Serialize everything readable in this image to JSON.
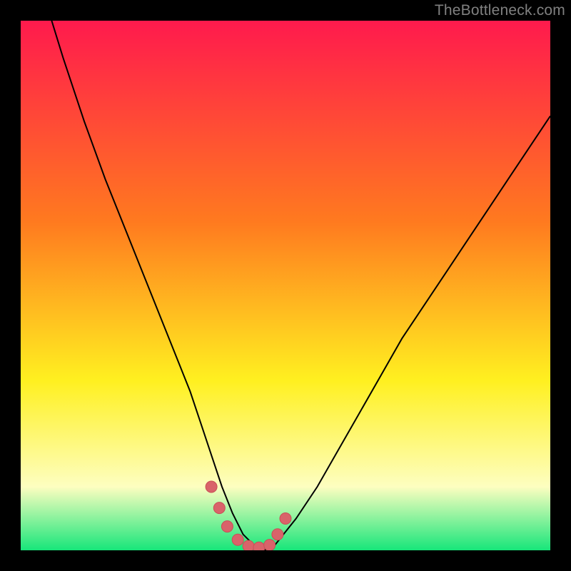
{
  "watermark": "TheBottleneck.com",
  "colors": {
    "frame": "#000000",
    "grad_top": "#ff1a4d",
    "grad_mid1": "#ff7a1f",
    "grad_mid2": "#fff020",
    "grad_low": "#fdfec0",
    "grad_bottom": "#17e67a",
    "curve": "#000000",
    "marker_fill": "#d9636a",
    "marker_stroke": "#c94f56"
  },
  "chart_data": {
    "type": "line",
    "title": "",
    "xlabel": "",
    "ylabel": "",
    "xlim": [
      0,
      100
    ],
    "ylim": [
      0,
      100
    ],
    "x": [
      0,
      4,
      8,
      12,
      16,
      20,
      24,
      28,
      30,
      32,
      34,
      36,
      38,
      40,
      42,
      44,
      46,
      48,
      52,
      56,
      60,
      64,
      68,
      72,
      76,
      80,
      84,
      88,
      92,
      96,
      100
    ],
    "values": [
      122,
      106,
      93,
      81,
      70,
      60,
      50,
      40,
      35,
      30,
      24,
      18,
      12,
      7,
      3,
      1,
      0,
      1,
      6,
      12,
      19,
      26,
      33,
      40,
      46,
      52,
      58,
      64,
      70,
      76,
      82
    ],
    "series": [
      {
        "name": "bottleneck-curve",
        "x": [
          0,
          4,
          8,
          12,
          16,
          20,
          24,
          28,
          30,
          32,
          34,
          36,
          38,
          40,
          42,
          44,
          46,
          48,
          52,
          56,
          60,
          64,
          68,
          72,
          76,
          80,
          84,
          88,
          92,
          96,
          100
        ],
        "values": [
          122,
          106,
          93,
          81,
          70,
          60,
          50,
          40,
          35,
          30,
          24,
          18,
          12,
          7,
          3,
          1,
          0,
          1,
          6,
          12,
          19,
          26,
          33,
          40,
          46,
          52,
          58,
          64,
          70,
          76,
          82
        ]
      }
    ],
    "markers": {
      "x": [
        36,
        37.5,
        39,
        41,
        43,
        45,
        47,
        48.5,
        50
      ],
      "y": [
        12,
        8,
        4.5,
        2,
        0.8,
        0.5,
        1,
        3,
        6
      ]
    }
  }
}
